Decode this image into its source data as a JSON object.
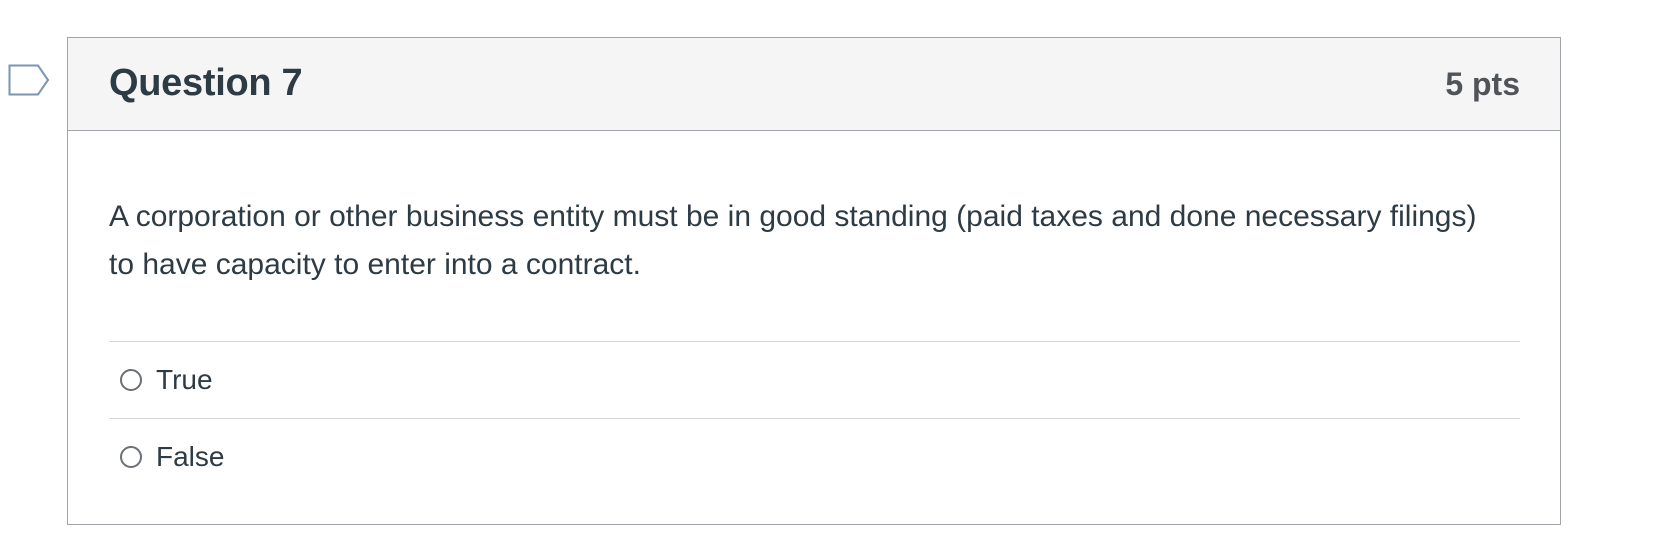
{
  "question": {
    "title": "Question 7",
    "points": "5 pts",
    "text": "A corporation or other business entity must be in good standing (paid taxes and done necessary filings) to have capacity to enter into a contract.",
    "answers": [
      {
        "label": "True"
      },
      {
        "label": "False"
      }
    ]
  },
  "icons": {
    "flag": "flag-question-icon"
  },
  "colors": {
    "header_bg": "#f5f5f5",
    "text": "#2d3b45",
    "points": "#4f5459",
    "border": "#a0a4a8",
    "flag": "#7a96b2"
  }
}
